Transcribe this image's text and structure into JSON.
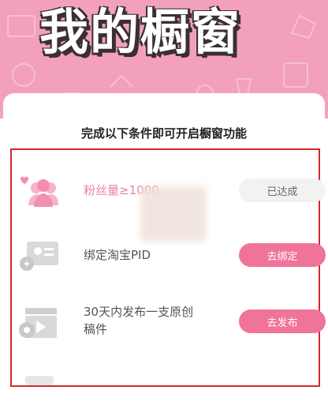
{
  "banner": {
    "title": "我的橱窗"
  },
  "heading": "完成以下条件即可开启橱窗功能",
  "conditions": [
    {
      "label": "粉丝量≥1000",
      "button": "已达成",
      "icon": "fans-icon"
    },
    {
      "label": "绑定淘宝PID",
      "button": "去绑定",
      "icon": "bind-id-card-icon"
    },
    {
      "label_line1": "30天内发布一支原创",
      "label_line2": "稿件",
      "button": "去发布",
      "icon": "video-camera-icon"
    }
  ],
  "colors": {
    "banner": "#f3a0bd",
    "accent": "#f0739a",
    "frame": "#d8262b"
  }
}
